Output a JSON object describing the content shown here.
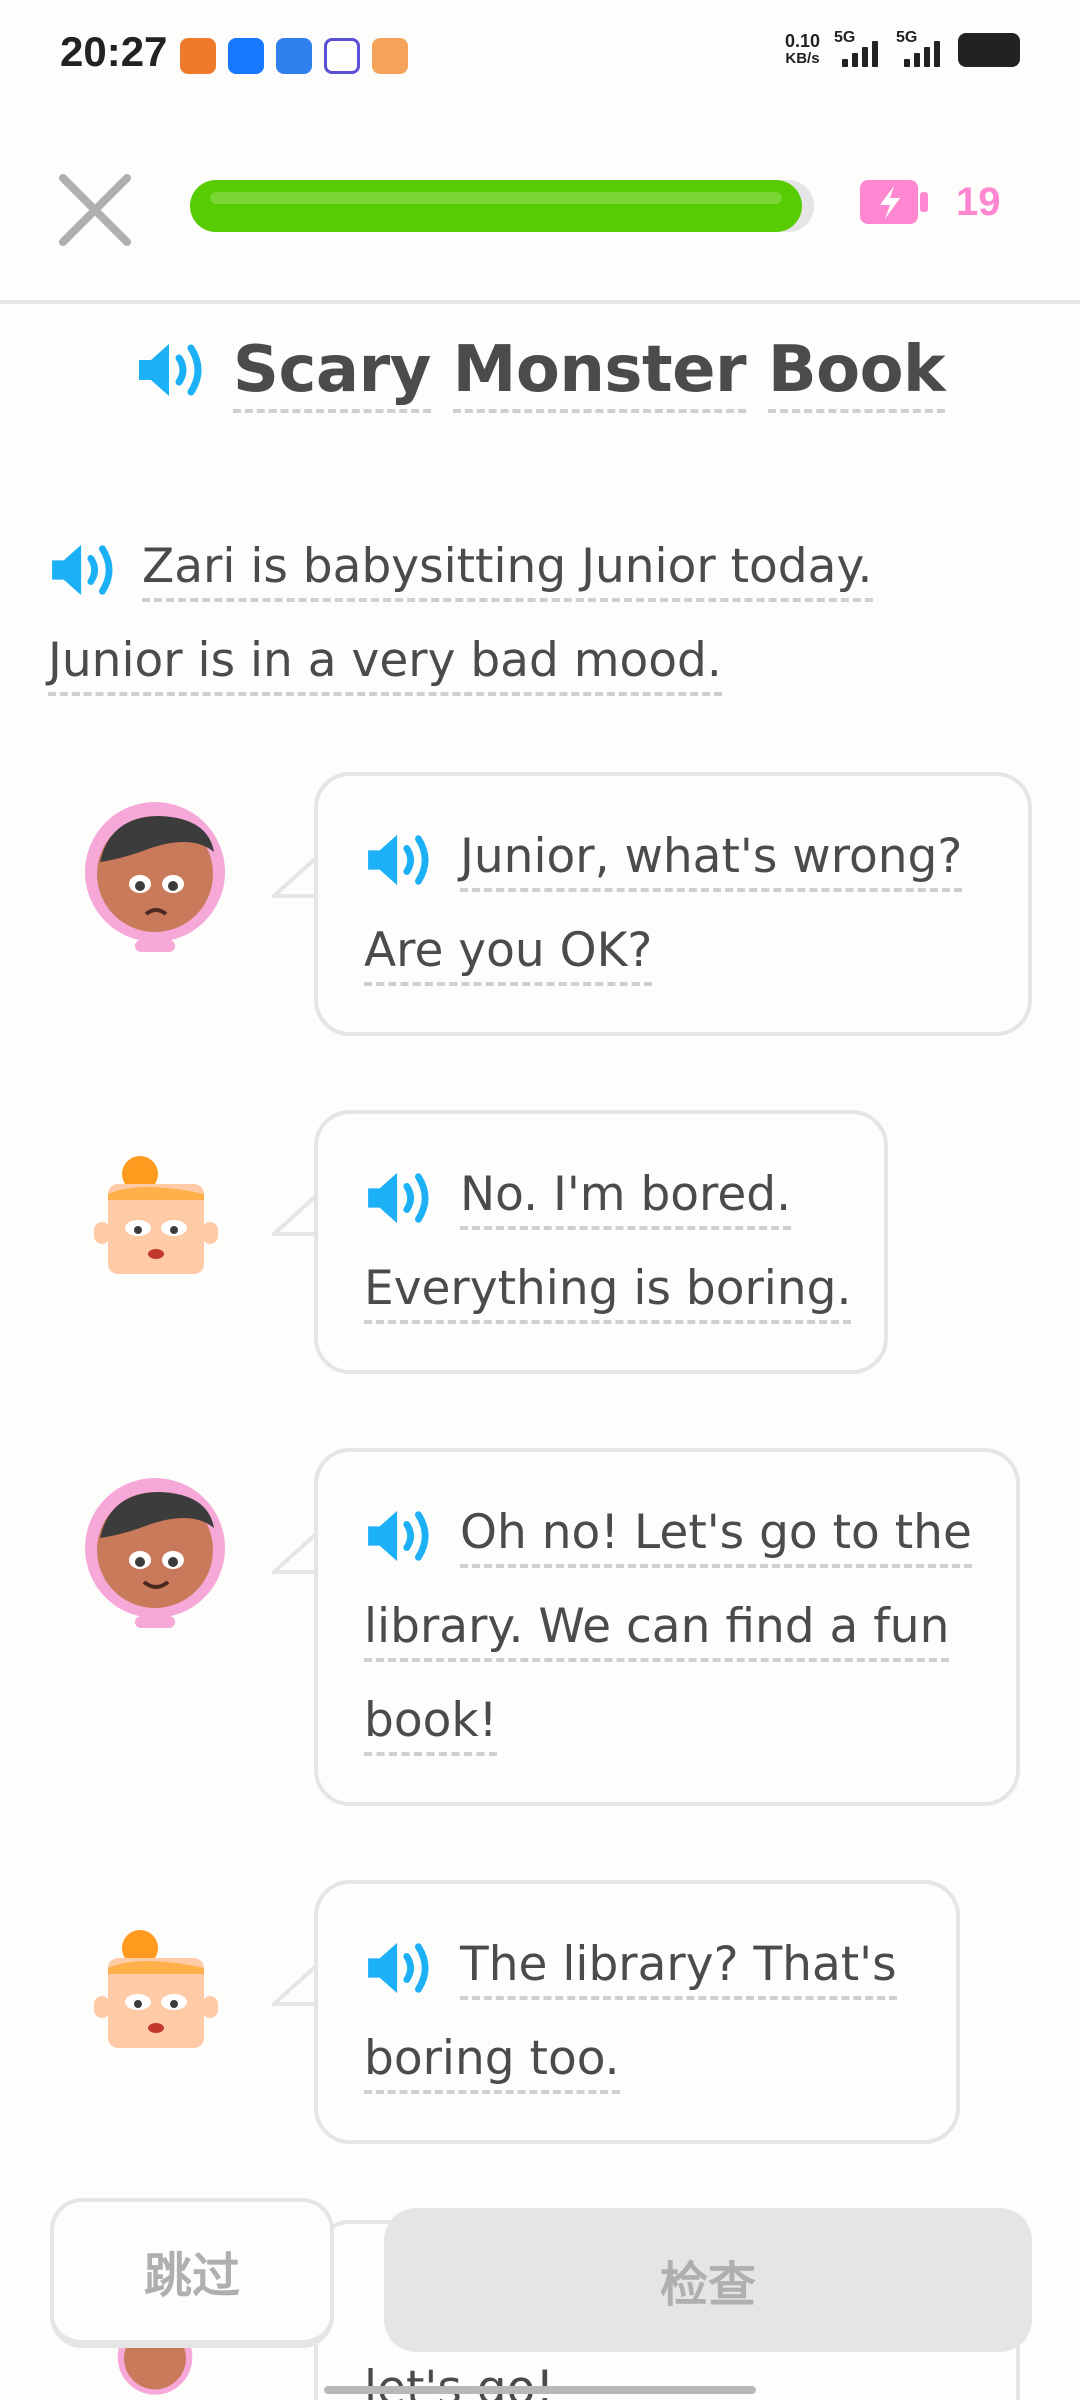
{
  "status_bar": {
    "time": "20:27",
    "net_speed_value": "0.10",
    "net_speed_unit": "KB/s",
    "signal_1_label": "5G",
    "signal_2_label": "5G"
  },
  "header": {
    "progress_fraction": 0.98,
    "energy_count": "19",
    "close_icon": "close-icon",
    "energy_icon": "battery-bolt-icon"
  },
  "story": {
    "title_words": [
      "Scary",
      "Monster",
      "Book"
    ],
    "narration_line1": "Zari is babysitting Junior today.",
    "narration_line2": "Junior is in a very bad mood."
  },
  "dialogue": [
    {
      "speaker": "Zari",
      "lines": [
        "Junior, what's wrong?",
        "Are you OK?"
      ]
    },
    {
      "speaker": "Junior",
      "lines": [
        "No. I'm bored.",
        "Everything is boring."
      ]
    },
    {
      "speaker": "Zari",
      "lines": [
        "Oh no! Let's go to the",
        "library. We can find a fun",
        "book!"
      ]
    },
    {
      "speaker": "Junior",
      "lines": [
        "The library? That's",
        "boring too."
      ]
    },
    {
      "speaker": "Zari",
      "lines": [
        "let's go!"
      ]
    }
  ],
  "footer": {
    "skip_label": "跳过",
    "check_label": "检查"
  },
  "colors": {
    "progress_green": "#58cc02",
    "energy_pink": "#ff86d0",
    "speaker_blue": "#1cb0f6",
    "text_gray": "#4b4b4b",
    "border_gray": "#e5e5e5"
  }
}
